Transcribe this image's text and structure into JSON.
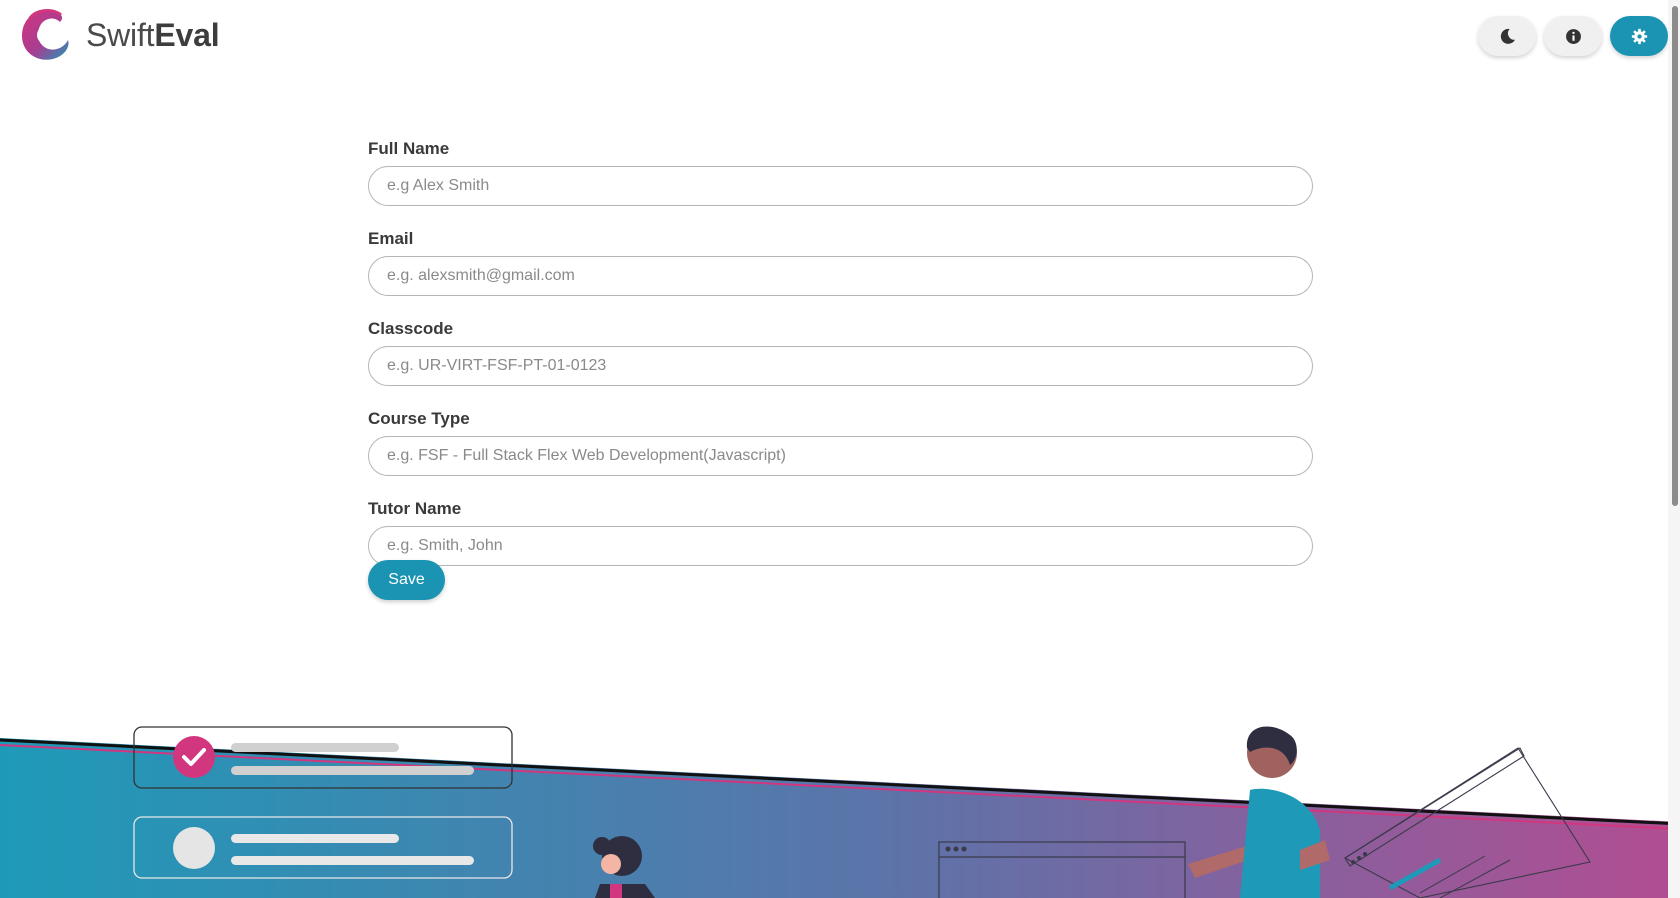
{
  "brand": {
    "name_light": "Swift",
    "name_bold": "Eval",
    "logo_icon": "swift-eval-logo"
  },
  "header": {
    "buttons": [
      {
        "icon": "moon-icon",
        "name": "dark-mode-button"
      },
      {
        "icon": "info-icon",
        "name": "info-button"
      },
      {
        "icon": "gear-icon",
        "name": "settings-button"
      }
    ]
  },
  "form": {
    "fields": [
      {
        "label": "Full Name",
        "placeholder": "e.g Alex Smith",
        "value": ""
      },
      {
        "label": "Email",
        "placeholder": "e.g. alexsmith@gmail.com",
        "value": ""
      },
      {
        "label": "Classcode",
        "placeholder": "e.g. UR-VIRT-FSF-PT-01-0123",
        "value": ""
      },
      {
        "label": "Course Type",
        "placeholder": "e.g. FSF - Full Stack Flex Web Development(Javascript)",
        "value": ""
      },
      {
        "label": "Tutor Name",
        "placeholder": "e.g. Smith, John",
        "value": ""
      }
    ],
    "save_label": "Save"
  },
  "colors": {
    "accent": "#1b93b3",
    "brand_pink": "#d2367e",
    "wave_start": "#1e9ab8",
    "wave_end": "#b24d92"
  }
}
